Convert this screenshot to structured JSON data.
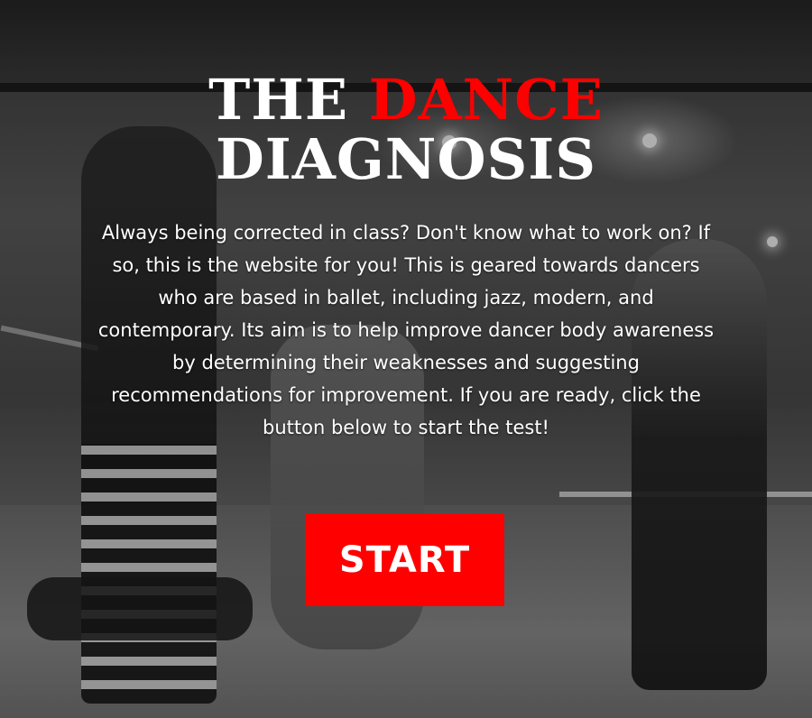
{
  "hero": {
    "title_part1": "THE",
    "title_accent": "DANCE",
    "title_line2": "DIAGNOSIS",
    "description": "Always being corrected in class? Don't know what to work on? If so, this is the website for you! This is geared towards dancers who are based in ballet, including jazz, modern, and contemporary. Its aim is to help improve dancer body awareness by determining their weaknesses and suggesting recommendations for improvement. If you are ready, click the button below to start the test!",
    "start_label": "START"
  },
  "colors": {
    "accent": "#ff0000",
    "text": "#ffffff"
  }
}
